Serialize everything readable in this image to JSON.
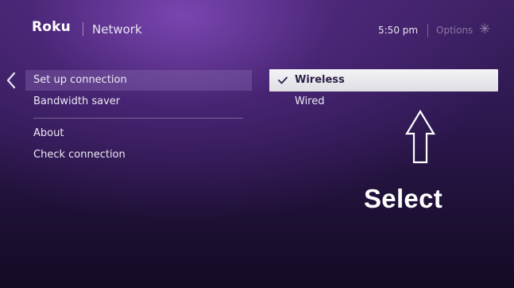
{
  "header": {
    "logo_text": "Roku",
    "title": "Network",
    "time": "5:50 pm",
    "options_label": "Options",
    "options_icon": "asterisk-icon"
  },
  "nav": {
    "back_icon": "chevron-left-icon"
  },
  "menu": {
    "items": [
      {
        "label": "Set up connection",
        "focused": true
      },
      {
        "label": "Bandwidth saver"
      },
      {
        "label": "About"
      },
      {
        "label": "Check connection"
      }
    ]
  },
  "connection_options": {
    "items": [
      {
        "label": "Wireless",
        "selected": true,
        "icon": "checkmark-icon"
      },
      {
        "label": "Wired",
        "selected": false
      }
    ]
  },
  "annotation": {
    "text": "Select",
    "arrow_icon": "up-arrow-icon"
  }
}
